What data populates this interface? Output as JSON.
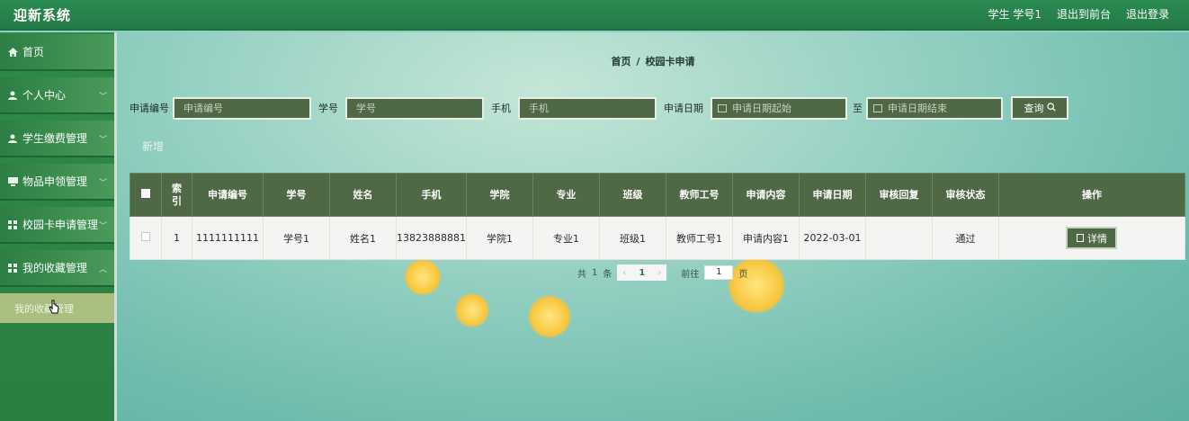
{
  "header": {
    "brand": "迎新系统",
    "user": "学生 学号1",
    "back_to_front": "退出到前台",
    "logout": "退出登录"
  },
  "sidebar": {
    "items": [
      {
        "label": "首页",
        "icon": "home-icon",
        "has_chevron": false
      },
      {
        "label": "个人中心",
        "icon": "user-icon",
        "has_chevron": true
      },
      {
        "label": "学生缴费管理",
        "icon": "user-icon",
        "has_chevron": true
      },
      {
        "label": "物品申领管理",
        "icon": "monitor-icon",
        "has_chevron": true
      },
      {
        "label": "校园卡申请管理",
        "icon": "grid-icon",
        "has_chevron": true
      },
      {
        "label": "我的收藏管理",
        "icon": "grid-icon",
        "has_chevron": true
      }
    ],
    "submenu_label": "我的收藏管理"
  },
  "breadcrumb": {
    "home": "首页",
    "separator": "/",
    "current": "校园卡申请"
  },
  "search": {
    "apply_no_label": "申请编号",
    "apply_no_placeholder": "申请编号",
    "student_no_label": "学号",
    "student_no_placeholder": "学号",
    "phone_label": "手机",
    "phone_placeholder": "手机",
    "date_label": "申请日期",
    "date_start_placeholder": "申请日期起始",
    "date_to": "至",
    "date_end_placeholder": "申请日期结束",
    "query_button": "查询"
  },
  "add_button": "新增",
  "table": {
    "columns": [
      "索引",
      "申请编号",
      "学号",
      "姓名",
      "手机",
      "学院",
      "专业",
      "班级",
      "教师工号",
      "申请内容",
      "申请日期",
      "审核回复",
      "审核状态",
      "操作"
    ],
    "rows": [
      {
        "index": "1",
        "apply_no": "1111111111",
        "student_no": "学号1",
        "name": "姓名1",
        "phone": "13823888881",
        "college": "学院1",
        "major": "专业1",
        "class": "班级1",
        "teacher_no": "教师工号1",
        "content": "申请内容1",
        "date": "2022-03-01",
        "reply": "",
        "status": "通过",
        "action": "详情"
      }
    ]
  },
  "pagination": {
    "total_prefix": "共",
    "total": "1",
    "total_suffix": "条",
    "current_page": "1",
    "goto_label": "前往",
    "goto_value": "1",
    "page_suffix": "页"
  },
  "colors": {
    "header_green": "#2c8b53",
    "button_green": "#4f6845",
    "submenu_bg": "#a9bf7f"
  }
}
